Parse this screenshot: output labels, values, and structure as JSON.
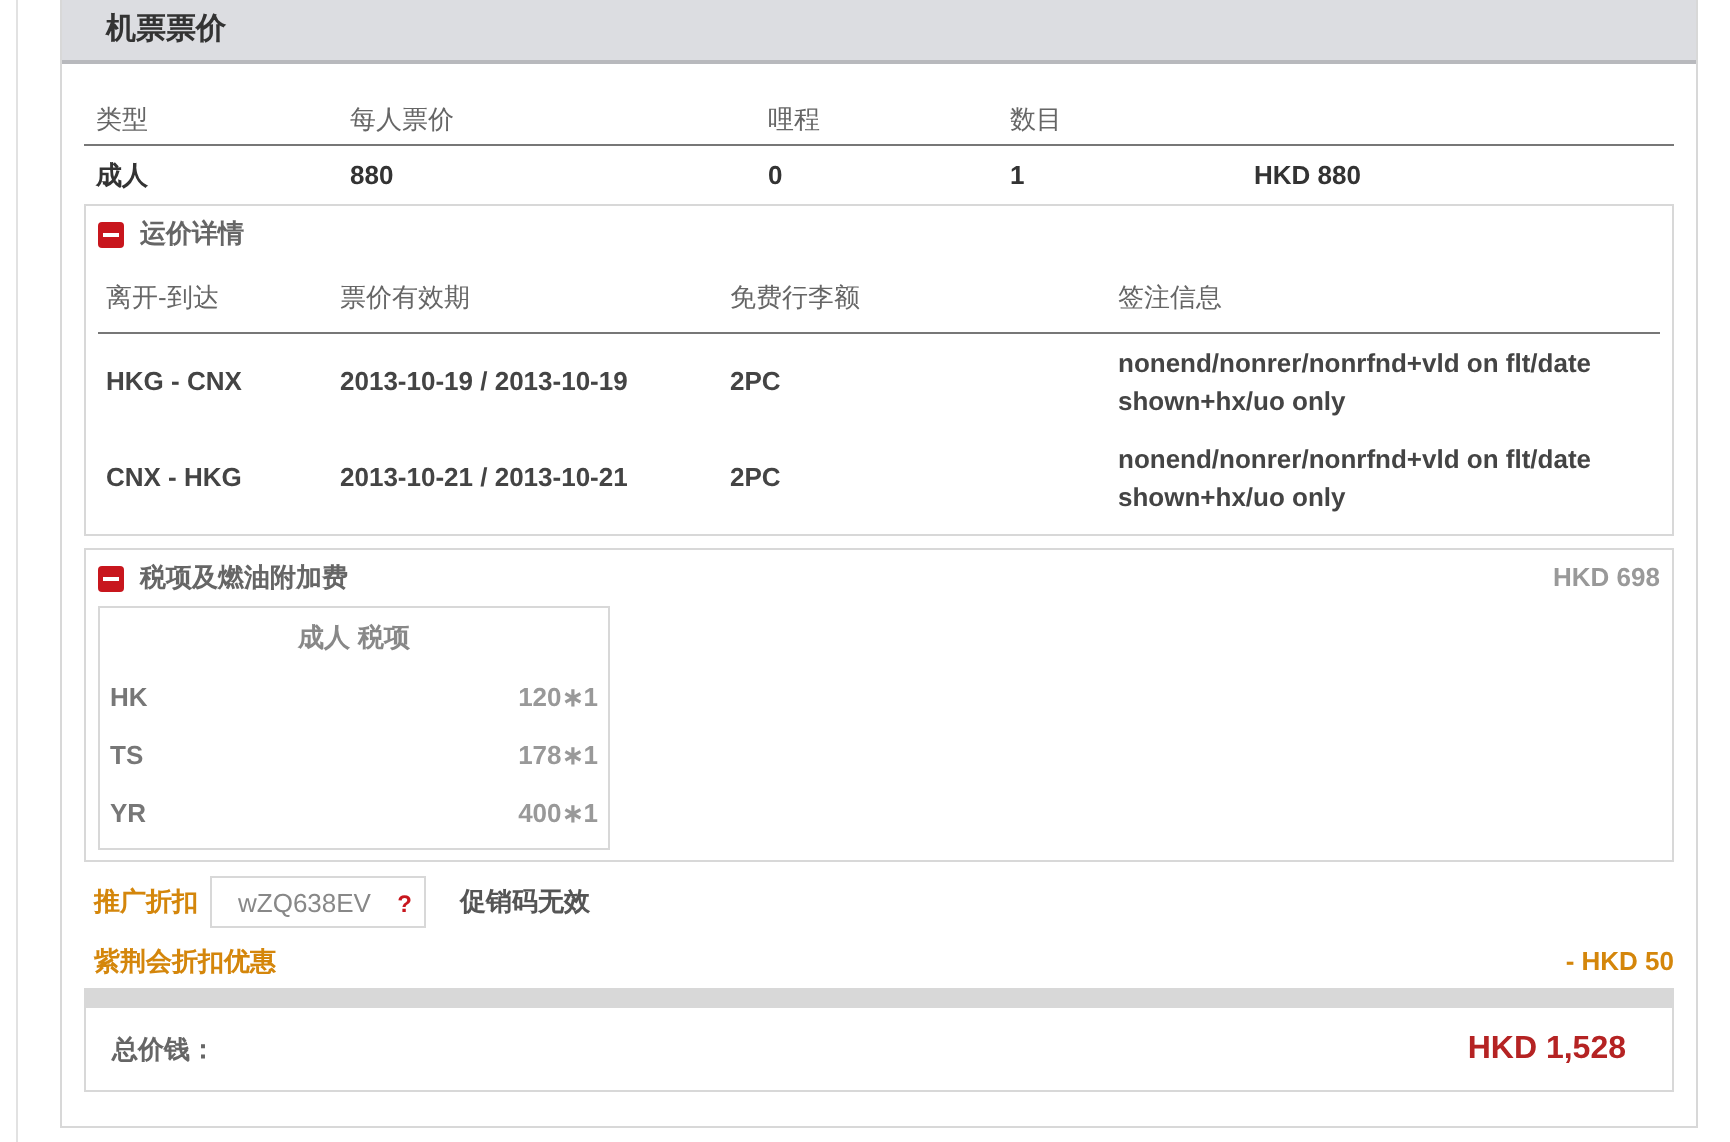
{
  "title": "机票票价",
  "fare_table": {
    "columns": [
      "类型",
      "每人票价",
      "哩程",
      "数目"
    ],
    "rows": [
      {
        "type": "成人",
        "price": "880",
        "miles": "0",
        "count": "1",
        "total": "HKD 880"
      }
    ]
  },
  "fare_details": {
    "title": "运价详情",
    "expanded": true,
    "columns": [
      "离开-到达",
      "票价有效期",
      "免费行李额",
      "签注信息"
    ],
    "rows": [
      {
        "route": "HKG - CNX",
        "validity": "2013-10-19 / 2013-10-19",
        "baggage": "2PC",
        "endorsement": "nonend/nonrer/nonrfnd+vld on flt/date shown+hx/uo only"
      },
      {
        "route": "CNX - HKG",
        "validity": "2013-10-21 / 2013-10-21",
        "baggage": "2PC",
        "endorsement": "nonend/nonrer/nonrfnd+vld on flt/date shown+hx/uo only"
      }
    ]
  },
  "taxes": {
    "title": "税项及燃油附加费",
    "expanded": true,
    "amount": "HKD 698",
    "table_title": "成人 税项",
    "rows": [
      {
        "code": "HK",
        "value": "120∗1"
      },
      {
        "code": "TS",
        "value": "178∗1"
      },
      {
        "code": "YR",
        "value": "400∗1"
      }
    ]
  },
  "promo": {
    "label": "推广折扣",
    "value": "wZQ638EV",
    "help": "?",
    "status": "促销码无效"
  },
  "member_discount": {
    "label": "紫荆会折扣优惠",
    "amount": "- HKD 50"
  },
  "total": {
    "label": "总价钱：",
    "amount": "HKD 1,528"
  }
}
